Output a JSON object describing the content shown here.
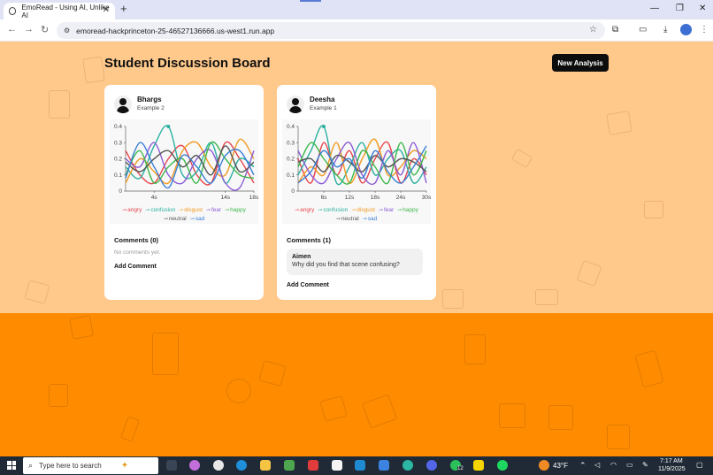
{
  "browser": {
    "tab_title": "EmoRead - Using AI, Unlike AI",
    "tab_close": "✕",
    "new_tab": "+",
    "url": "emoread-hackprinceton-25-46527136666.us-west1.run.app",
    "back": "←",
    "forward": "→",
    "reload": "↻",
    "star": "☆",
    "minimize": "—",
    "restore": "❐",
    "close": "✕",
    "menu": "⋮"
  },
  "page": {
    "title": "Student Discussion Board",
    "new_analysis_label": "New Analysis",
    "background_colors": {
      "top": "#ffc98b",
      "bottom": "#ff8c00"
    }
  },
  "emotions": [
    {
      "name": "angry",
      "color": "#e8454f"
    },
    {
      "name": "confusion",
      "color": "#2bb0a0"
    },
    {
      "name": "disgust",
      "color": "#f39a1f"
    },
    {
      "name": "fear",
      "color": "#8a5cd6"
    },
    {
      "name": "happy",
      "color": "#3cb84a"
    },
    {
      "name": "neutral",
      "color": "#555555"
    },
    {
      "name": "sad",
      "color": "#3a7fd6"
    }
  ],
  "cards": [
    {
      "user": "Bhargs",
      "subtitle": "Example 2",
      "comments_title": "Comments (0)",
      "no_comments_text": "No comments yet.",
      "comments": [],
      "add_comment_label": "Add Comment"
    },
    {
      "user": "Deesha",
      "subtitle": "Example 1",
      "comments_title": "Comments (1)",
      "no_comments_text": "",
      "comments": [
        {
          "author": "Aimen",
          "text": "Why did you find that scene confusing?"
        }
      ],
      "add_comment_label": "Add Comment"
    }
  ],
  "chart_data": [
    {
      "type": "line",
      "title": "",
      "y_ticks": [
        "0",
        "0.1",
        "0.2",
        "0.3",
        "0.4"
      ],
      "ylim": [
        0,
        0.4
      ],
      "x_ticks": [
        "4s",
        "14s",
        "18s"
      ],
      "x_tick_values": [
        4,
        14,
        18
      ],
      "xlim": [
        0,
        18
      ],
      "x": [
        0,
        2,
        4,
        6,
        8,
        10,
        12,
        14,
        16,
        18
      ],
      "series": [
        {
          "name": "angry",
          "values": [
            0.25,
            0.1,
            0.05,
            0.2,
            0.28,
            0.1,
            0.05,
            0.3,
            0.2,
            0.05
          ]
        },
        {
          "name": "confusion",
          "values": [
            0.15,
            0.08,
            0.28,
            0.4,
            0.1,
            0.12,
            0.3,
            0.05,
            0.2,
            0.15
          ]
        },
        {
          "name": "disgust",
          "values": [
            0.05,
            0.2,
            0.12,
            0.05,
            0.25,
            0.3,
            0.15,
            0.1,
            0.32,
            0.2
          ]
        },
        {
          "name": "fear",
          "values": [
            0.2,
            0.15,
            0.3,
            0.1,
            0.05,
            0.2,
            0.25,
            0.05,
            0.02,
            0.25
          ]
        },
        {
          "name": "happy",
          "values": [
            0.1,
            0.25,
            0.05,
            0.15,
            0.2,
            0.05,
            0.3,
            0.2,
            0.1,
            0.08
          ]
        },
        {
          "name": "neutral",
          "values": [
            0.18,
            0.12,
            0.2,
            0.25,
            0.15,
            0.22,
            0.1,
            0.28,
            0.12,
            0.18
          ]
        },
        {
          "name": "sad",
          "values": [
            0.08,
            0.3,
            0.15,
            0.02,
            0.22,
            0.15,
            0.05,
            0.22,
            0.25,
            0.1
          ]
        }
      ]
    },
    {
      "type": "line",
      "title": "",
      "y_ticks": [
        "0",
        "0.1",
        "0.2",
        "0.3",
        "0.4"
      ],
      "ylim": [
        0,
        0.4
      ],
      "x_ticks": [
        "6s",
        "12s",
        "18s",
        "24s",
        "30s"
      ],
      "x_tick_values": [
        6,
        12,
        18,
        24,
        30
      ],
      "xlim": [
        0,
        30
      ],
      "x": [
        0,
        3,
        6,
        9,
        12,
        15,
        18,
        21,
        24,
        27,
        30
      ],
      "series": [
        {
          "name": "angry",
          "values": [
            0.2,
            0.05,
            0.3,
            0.1,
            0.25,
            0.05,
            0.2,
            0.3,
            0.05,
            0.2,
            0.1
          ]
        },
        {
          "name": "confusion",
          "values": [
            0.1,
            0.25,
            0.4,
            0.05,
            0.15,
            0.3,
            0.1,
            0.2,
            0.25,
            0.05,
            0.15
          ]
        },
        {
          "name": "disgust",
          "values": [
            0.05,
            0.15,
            0.1,
            0.3,
            0.05,
            0.2,
            0.32,
            0.1,
            0.15,
            0.25,
            0.2
          ]
        },
        {
          "name": "fear",
          "values": [
            0.25,
            0.1,
            0.05,
            0.2,
            0.3,
            0.1,
            0.05,
            0.25,
            0.1,
            0.3,
            0.05
          ]
        },
        {
          "name": "happy",
          "values": [
            0.15,
            0.3,
            0.2,
            0.1,
            0.05,
            0.25,
            0.15,
            0.05,
            0.3,
            0.1,
            0.25
          ]
        },
        {
          "name": "neutral",
          "values": [
            0.18,
            0.2,
            0.12,
            0.22,
            0.18,
            0.12,
            0.22,
            0.15,
            0.2,
            0.18,
            0.12
          ]
        },
        {
          "name": "sad",
          "values": [
            0.05,
            0.12,
            0.25,
            0.15,
            0.2,
            0.08,
            0.25,
            0.12,
            0.05,
            0.15,
            0.28
          ]
        }
      ]
    }
  ],
  "taskbar": {
    "search_placeholder": "Type here to search",
    "weather": "43°F",
    "time": "7:17 AM",
    "date": "11/9/2025",
    "badge_count": "12"
  }
}
